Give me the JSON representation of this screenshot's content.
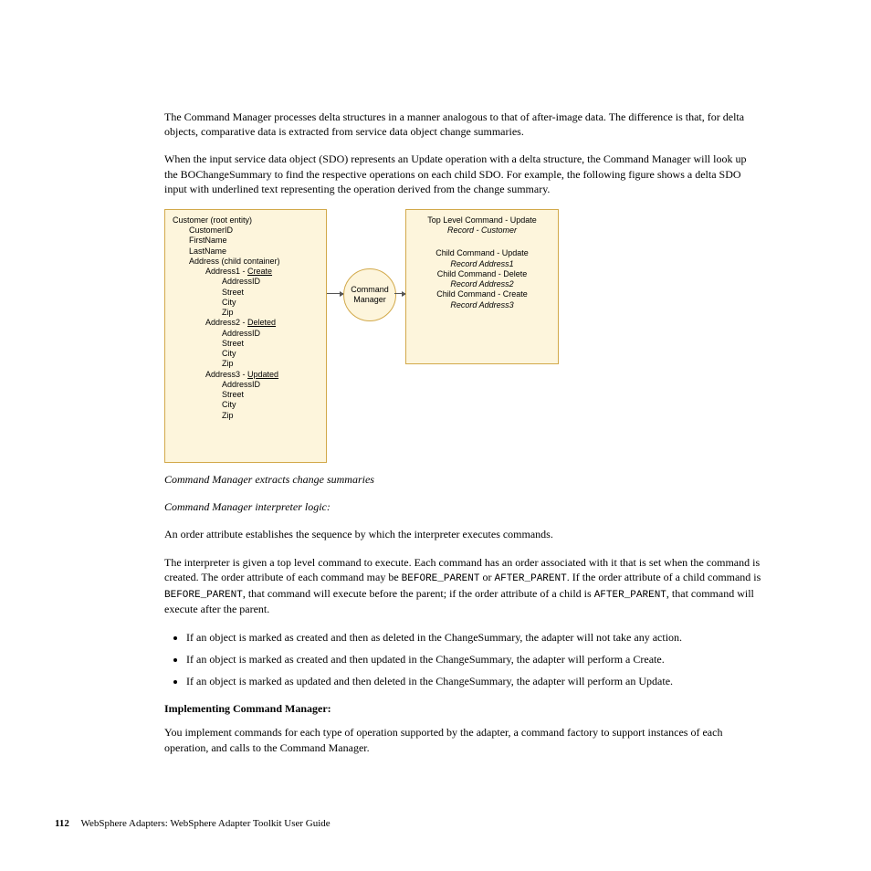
{
  "para1": "The Command Manager processes delta structures in a manner analogous to that of after-image data. The difference is that, for delta objects, comparative data is extracted from service data object change summaries.",
  "para2": "When the input service data object (SDO) represents an Update operation with a delta structure, the Command Manager will look up the BOChangeSummary to find the respective operations on each child SDO. For example, the following figure shows a delta SDO input with underlined text representing the operation derived from the change summary.",
  "diagram": {
    "left": {
      "l1": "Customer (root entity)",
      "l2": "CustomerID",
      "l3": "FirstName",
      "l4": "LastName",
      "l5": "Address (child container)",
      "a1_label": "Address1 - ",
      "a1_op": "Create",
      "a2_label": "Address2 - ",
      "a2_op": "Deleted",
      "a3_label": "Address3 - ",
      "a3_op": "Updated",
      "f1": "AddressID",
      "f2": "Street",
      "f3": "City",
      "f4": "Zip"
    },
    "center": "Command\nManager",
    "right": {
      "t1": "Top Level Command - Update",
      "t2": "Record - Customer",
      "c1": "Child Command - Update",
      "c1r": "Record Address1",
      "c2": "Child Command - Delete",
      "c2r": "Record Address2",
      "c3": "Child Command - Create",
      "c3r": "Record Address3"
    }
  },
  "caption1": "Command Manager extracts change summaries",
  "caption2": "Command Manager interpreter logic:",
  "para3": "An order attribute establishes the sequence by which the interpreter executes commands.",
  "para4a": "The interpreter is given a top level command to execute. Each command has an order associated with it that is set when the command is created. The order attribute of each command may be ",
  "code1": "BEFORE_PARENT",
  "para4b": " or ",
  "code2": "AFTER_PARENT",
  "para4c": ". If the order attribute of a child command is ",
  "para4d": ", that command will execute before the parent; if the order attribute of a child is ",
  "para4e": ", that command will execute after the parent.",
  "bullets": {
    "b1": "If an object is marked as created and then as deleted in the ChangeSummary, the adapter will not take any action.",
    "b2": "If an object is marked as created and then updated in the ChangeSummary, the adapter will perform a Create.",
    "b3": "If an object is marked as updated and then deleted in the ChangeSummary, the adapter will perform an Update."
  },
  "heading": "Implementing Command Manager:",
  "para5": "You implement commands for each type of operation supported by the adapter, a command factory to support instances of each operation, and calls to the Command Manager.",
  "footer": {
    "page": "112",
    "title": "WebSphere Adapters: WebSphere Adapter Toolkit User Guide"
  }
}
